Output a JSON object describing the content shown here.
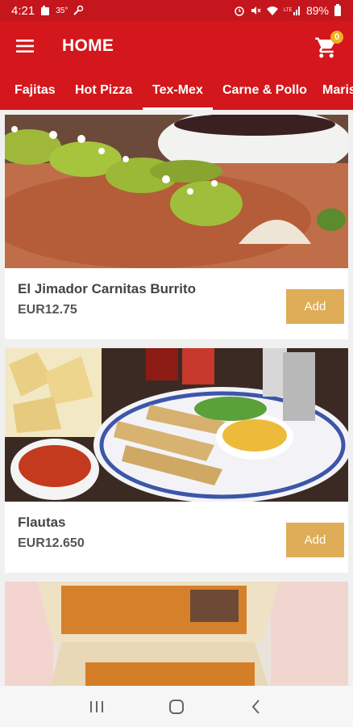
{
  "status": {
    "time": "4:21",
    "temp": "35°",
    "battery": "89%"
  },
  "app": {
    "title": "HOME",
    "cart_count": "0"
  },
  "tabs": [
    "Fajitas",
    "Hot Pizza",
    "Tex-Mex",
    "Carne & Pollo",
    "Maris"
  ],
  "active_tab": "Tex-Mex",
  "items": [
    {
      "name": "El Jimador Carnitas Burrito",
      "price": "EUR12.75",
      "button": "Add"
    },
    {
      "name": "Flautas",
      "price": "EUR12.650",
      "button": "Add"
    }
  ],
  "colors": {
    "primary": "#d3171c",
    "status": "#c4161c",
    "accent": "#dfad57",
    "badge": "#f2b11e"
  },
  "icons": [
    "menu-icon",
    "cart-icon",
    "recent-apps-icon",
    "home-nav-icon",
    "back-nav-icon"
  ]
}
